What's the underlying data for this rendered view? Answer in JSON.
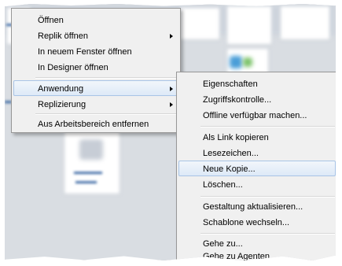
{
  "menu_primary": {
    "items": [
      {
        "label": "Öffnen",
        "submenu": false
      },
      {
        "label": "Replik öffnen",
        "submenu": true
      },
      {
        "label": "In neuem Fenster öffnen",
        "submenu": false
      },
      {
        "label": "In Designer öffnen",
        "submenu": false
      },
      {
        "label": "Anwendung",
        "submenu": true,
        "highlighted": true
      },
      {
        "label": "Replizierung",
        "submenu": true
      },
      {
        "label": "Aus Arbeitsbereich entfernen",
        "submenu": false
      }
    ]
  },
  "menu_submenu": {
    "parent": "Anwendung",
    "items": [
      {
        "label": "Eigenschaften"
      },
      {
        "label": "Zugriffskontrolle..."
      },
      {
        "label": "Offline verfügbar machen..."
      },
      {
        "label": "Als Link kopieren"
      },
      {
        "label": "Lesezeichen..."
      },
      {
        "label": "Neue Kopie...",
        "highlighted": true
      },
      {
        "label": "Löschen..."
      },
      {
        "label": "Gestaltung aktualisieren..."
      },
      {
        "label": "Schablone wechseln..."
      },
      {
        "label": "Gehe zu..."
      },
      {
        "label": "Gehe zu Agenten"
      }
    ]
  },
  "colors": {
    "menu_background": "#f0f0f0",
    "highlight_border": "#a8c4e6",
    "workspace_background": "#d9dde2"
  }
}
